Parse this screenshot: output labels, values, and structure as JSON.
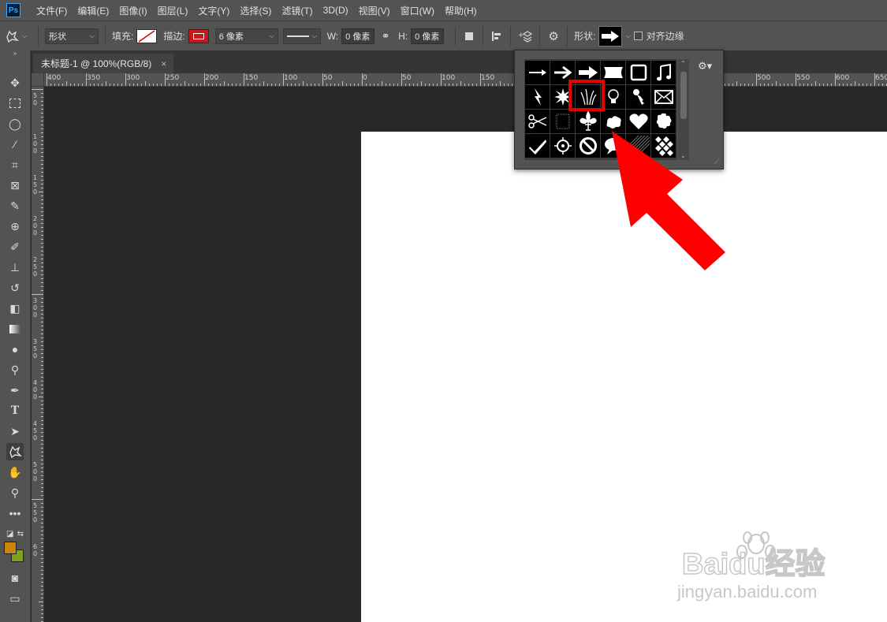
{
  "app": {
    "logo": "Ps"
  },
  "menu": [
    "文件(F)",
    "编辑(E)",
    "图像(I)",
    "图层(L)",
    "文字(Y)",
    "选择(S)",
    "滤镜(T)",
    "3D(D)",
    "视图(V)",
    "窗口(W)",
    "帮助(H)"
  ],
  "options": {
    "mode_value": "形状",
    "fill_label": "填充:",
    "stroke_label": "描边:",
    "stroke_width": "6 像素",
    "w_label": "W:",
    "w_value": "0 像素",
    "h_label": "H:",
    "h_value": "0 像素",
    "shape_label": "形状:",
    "align_edges_label": "对齐边缘",
    "align_edges_checked": false
  },
  "document": {
    "tab_title": "未标题-1 @ 100%(RGB/8)",
    "close_glyph": "×"
  },
  "ruler": {
    "h_labels": [
      "400",
      "350",
      "300",
      "250",
      "200",
      "150",
      "100",
      "50",
      "0",
      "50",
      "100",
      "150",
      "500",
      "550",
      "600",
      "650"
    ],
    "v_labels": [
      "5\n0",
      "1\n0\n0",
      "1\n5\n0",
      "2\n0\n0",
      "2\n5\n0",
      "3\n0\n0",
      "3\n5\n0",
      "4\n0\n0",
      "4\n5\n0",
      "5\n0\n0",
      "5\n5\n0",
      "6\n0"
    ]
  },
  "shape_picker": {
    "shapes": [
      "arrow-thin",
      "arrow-medium",
      "arrow-bold",
      "banner",
      "frame",
      "music-note",
      "lightning",
      "starburst",
      "grass",
      "lightbulb",
      "key",
      "envelope",
      "scissors",
      "dotted-frame",
      "fleur-de-lis",
      "ornament",
      "heart",
      "puzzle",
      "checkmark",
      "target",
      "forbidden",
      "speech-bubble",
      "hatch-pattern",
      "diamond-grid"
    ],
    "selected_index": 8
  },
  "colors": {
    "foreground": "#c8860d",
    "background": "#7ca21e",
    "highlight": "#e60000",
    "arrow": "#ff0000",
    "stroke_swatch": "#c8161d"
  },
  "watermark": {
    "brand": "Baidu经验",
    "url": "jingyan.baidu.com"
  }
}
